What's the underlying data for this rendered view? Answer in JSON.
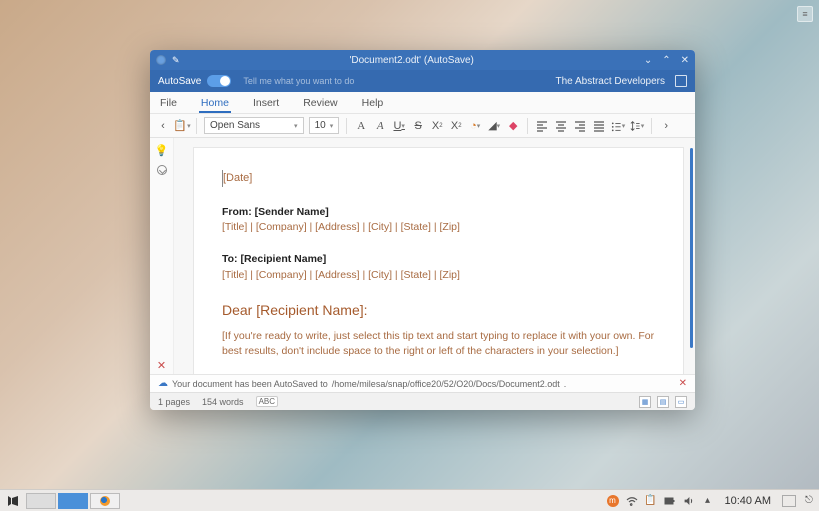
{
  "titlebar": {
    "title": "'Document2.odt' (AutoSave)"
  },
  "header": {
    "autosave_label": "AutoSave",
    "tell_me_placeholder": "Tell me what you want to do",
    "brand": "The Abstract Developers"
  },
  "menu": {
    "file": "File",
    "home": "Home",
    "insert": "Insert",
    "review": "Review",
    "help": "Help"
  },
  "toolbar": {
    "font_name": "Open Sans",
    "font_size": "10"
  },
  "document": {
    "date_field": "[Date]",
    "from_label": "From:",
    "from_name": "[Sender Name]",
    "from_line": "[Title] | [Company] | [Address] | [City] | [State] | [Zip]",
    "to_label": "To:",
    "to_name": "[Recipient Name]",
    "to_line": "[Title] | [Company] | [Address] | [City] | [State] | [Zip]",
    "salutation": "Dear [Recipient Name]:",
    "body_tip": "[If you're ready to write, just select this tip text and start typing to replace it with your own. For best results, don't include space to the right or left of the characters in your selection.]"
  },
  "autosave_msg": {
    "prefix": "Your document has been AutoSaved to ",
    "path": "/home/milesa/snap/office20/52/O20/Docs/Document2.odt"
  },
  "status": {
    "pages": "1 pages",
    "words": "154 words",
    "abc": "ABC"
  },
  "taskbar": {
    "clock": "10:40 AM"
  }
}
